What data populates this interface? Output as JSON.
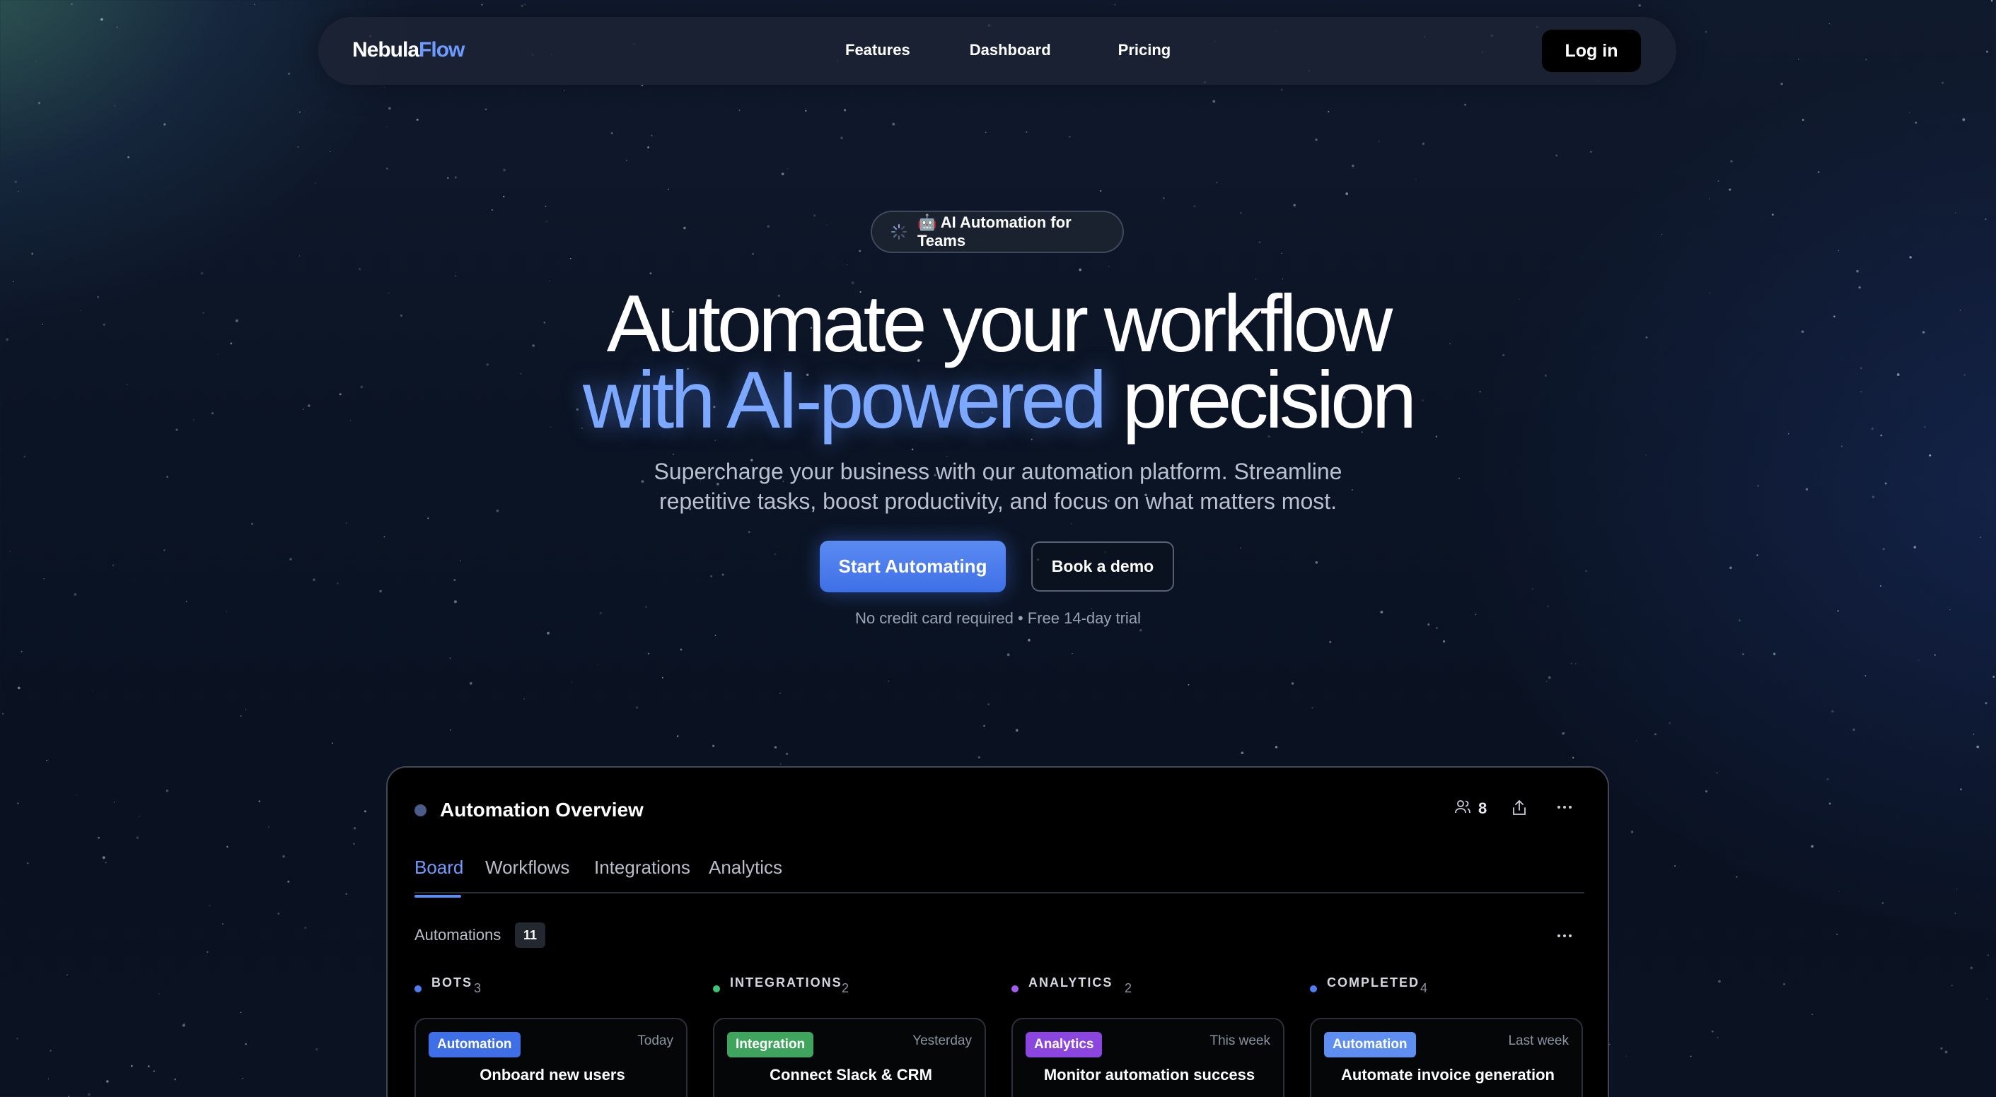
{
  "nav": {
    "brand_part1": "Nebula",
    "brand_part2": "Flow",
    "links": [
      "Features",
      "Dashboard",
      "Pricing"
    ],
    "login_label": "Log in"
  },
  "hero": {
    "pill_icon": "robot-icon",
    "pill_text": "🤖 AI Automation for Teams",
    "headline_line1": "Automate your workflow",
    "headline_accent": "with AI-powered",
    "headline_rest": "precision",
    "subtitle_line1": "Supercharge your business with our automation platform. Streamline",
    "subtitle_line2": "repetitive tasks, boost productivity, and focus on what matters most.",
    "primary_cta": "Start Automating",
    "secondary_cta": "Book a demo",
    "fine_print": "No credit card required • Free 14-day trial"
  },
  "panel": {
    "title": "Automation Overview",
    "member_count": "8",
    "tabs": [
      "Board",
      "Workflows",
      "Integrations",
      "Analytics"
    ],
    "active_tab": "Board",
    "automations_label": "Automations",
    "automations_count": "11",
    "columns": [
      {
        "name": "BOTS",
        "count": "3",
        "dot_color": "#4f7cf0",
        "card": {
          "badge": "Automation",
          "badge_color": "#3f6fe6",
          "time": "Today",
          "title": "Onboard new users"
        }
      },
      {
        "name": "INTEGRATIONS",
        "count": "2",
        "dot_color": "#3ec276",
        "card": {
          "badge": "Integration",
          "badge_color": "#3fa45d",
          "time": "Yesterday",
          "title": "Connect Slack & CRM"
        }
      },
      {
        "name": "ANALYTICS",
        "count": "2",
        "dot_color": "#a35cf0",
        "card": {
          "badge": "Analytics",
          "badge_color": "#8b46e0",
          "time": "This week",
          "title": "Monitor automation success"
        }
      },
      {
        "name": "COMPLETED",
        "count": "4",
        "dot_color": "#4f7cf0",
        "card": {
          "badge": "Automation",
          "badge_color": "#5e8ef0",
          "time": "Last week",
          "title": "Automate invoice generation"
        }
      }
    ]
  },
  "colors": {
    "accent": "#6d9bff",
    "primary_button": "#4a7cf0",
    "background": "#0b1424"
  }
}
